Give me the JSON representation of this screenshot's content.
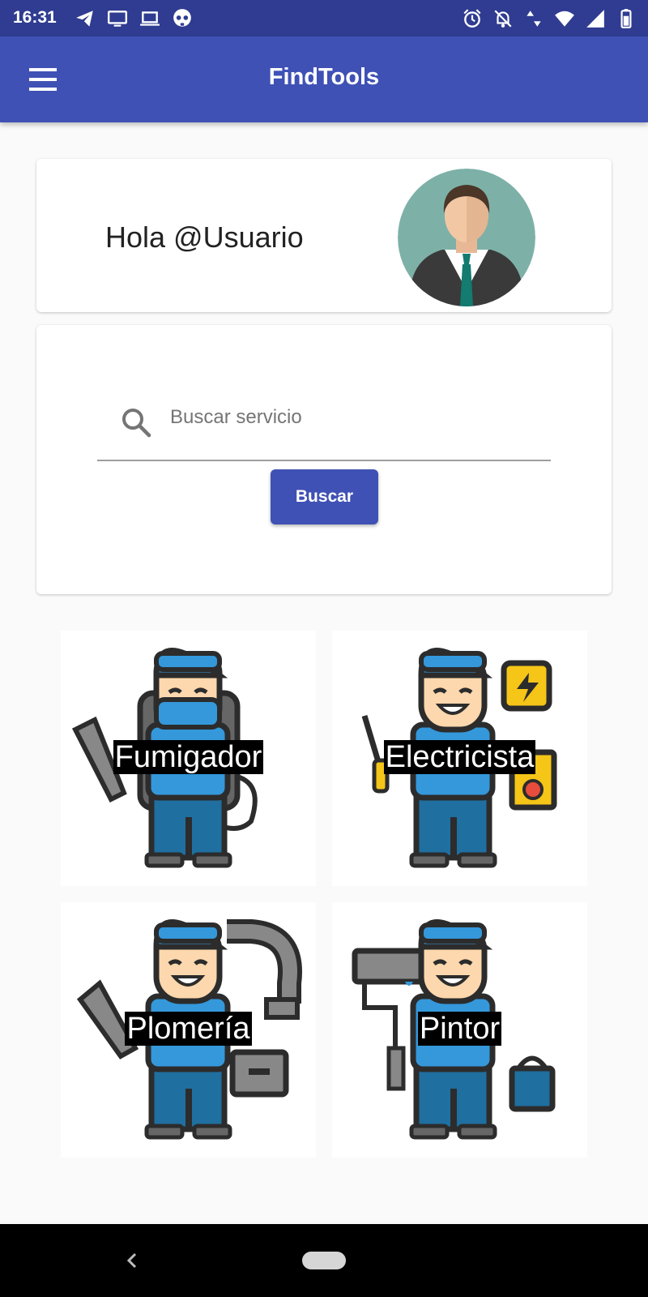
{
  "status_bar": {
    "time": "16:31",
    "left_icons": [
      "telegram-icon",
      "monitor-icon",
      "laptop-icon",
      "skull-icon"
    ],
    "right_icons": [
      "alarm-icon",
      "notifications-off-icon",
      "data-arrows-icon",
      "wifi-icon",
      "signal-icon",
      "battery-icon"
    ]
  },
  "app_bar": {
    "title": "FindTools",
    "menu_icon": "menu-icon"
  },
  "greeting": {
    "text": "Hola @Usuario",
    "avatar": "businessman-avatar"
  },
  "search": {
    "placeholder": "Buscar servicio",
    "value": "",
    "button_label": "Buscar"
  },
  "services": [
    {
      "label": "Fumigador",
      "icon": "fumigator-worker-illustration"
    },
    {
      "label": "Electricista",
      "icon": "electrician-worker-illustration"
    },
    {
      "label": "Plomería",
      "icon": "plumber-worker-illustration"
    },
    {
      "label": "Pintor",
      "icon": "painter-worker-illustration"
    }
  ],
  "colors": {
    "status_bar": "#2f3c91",
    "primary": "#3f51b5",
    "background": "#fafafa",
    "worker_blue": "#3498db",
    "worker_dark_blue": "#1f6fa0",
    "skin": "#fdd7ad",
    "outline": "#2c2c2c"
  }
}
